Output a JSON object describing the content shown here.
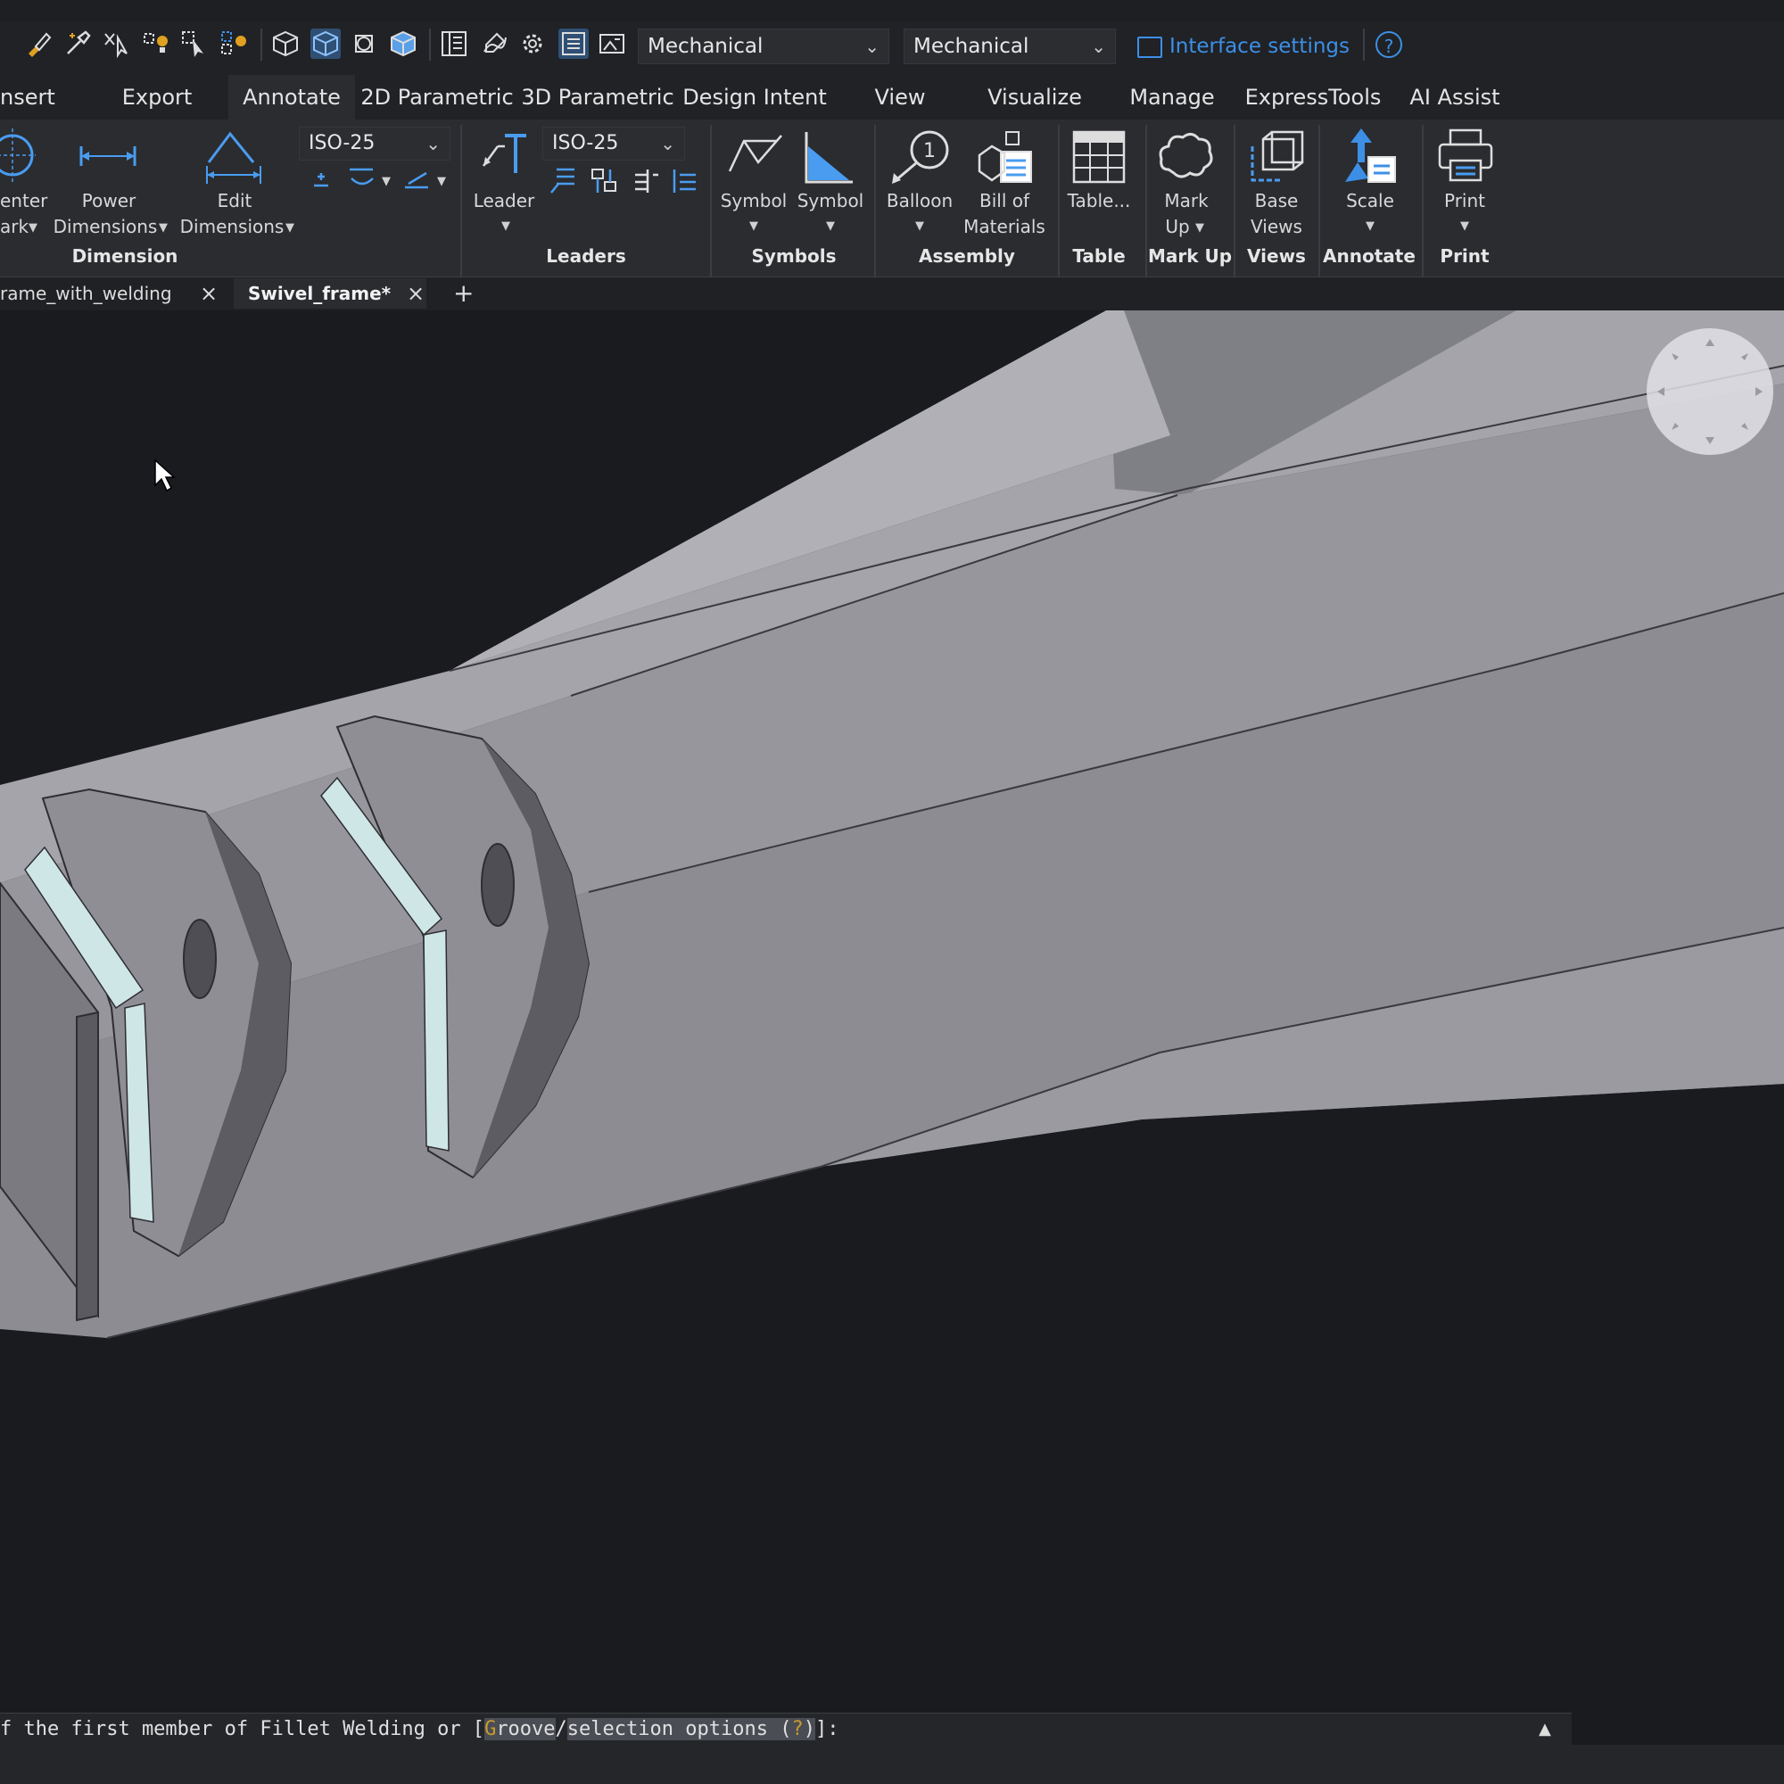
{
  "toolbar": {
    "icons": [
      "brush-icon",
      "eyedropper-icon",
      "select-filter-icon",
      "bulb-select-icon",
      "select-similar-icon",
      "bulb-multi-icon",
      "cube-wireframe-icon",
      "cube-shaded-icon",
      "visual-style-icon",
      "cube-render-icon",
      "properties-panel-icon",
      "draw-pen-icon",
      "gear-icon",
      "layer-panel-icon",
      "image-panel-icon"
    ],
    "workspace_value": "Mechanical",
    "style_value": "Mechanical",
    "interface_settings_label": "Interface settings",
    "help_label": "?"
  },
  "ribbon_tabs": [
    "nsert",
    "Export",
    "Annotate",
    "2D Parametric",
    "3D Parametric",
    "Design Intent",
    "View",
    "Visualize",
    "Manage",
    "ExpressTools",
    "AI Assist"
  ],
  "ribbon": {
    "center_mark_label_1": "enter",
    "center_mark_label_2": "ark",
    "power_dimensions_label_1": "Power",
    "power_dimensions_label_2": "Dimensions",
    "edit_dimensions_label_1": "Edit",
    "edit_dimensions_label_2": "Dimensions",
    "dimension_style_value": "ISO-25",
    "leader_label": "Leader",
    "leader_style_value": "ISO-25",
    "symbol1_label": "Symbol",
    "symbol2_label": "Symbol",
    "balloon_label": "Balloon",
    "balloon_number": "1",
    "bom_label_1": "Bill of",
    "bom_label_2": "Materials",
    "table_label": "Table...",
    "markup_label_1": "Mark",
    "markup_label_2": "Up",
    "baseviews_label_1": "Base",
    "baseviews_label_2": "Views",
    "scale_label": "Scale",
    "print_label": "Print",
    "groups": {
      "dimension": "Dimension",
      "leaders": "Leaders",
      "symbols": "Symbols",
      "assembly": "Assembly",
      "table": "Table",
      "markup": "Mark Up",
      "views": "Views",
      "annotate": "Annotate",
      "print": "Print"
    }
  },
  "document_tabs": [
    {
      "label": "rame_with_welding",
      "active": false
    },
    {
      "label": "Swivel_frame*",
      "active": true
    }
  ],
  "new_tab_label": "+",
  "close_label": "×",
  "command_line": {
    "prefix": "f the first member of Fillet Welding or [",
    "option1_key": "G",
    "option1_rest": "roove",
    "divider": "/",
    "option2_text": "selection options (",
    "option2_key": "?",
    "option2_end": ")",
    "suffix": "]:"
  },
  "colors": {
    "accent": "#3d8fe6",
    "weld_bead": "#cfe6e6",
    "part_light": "#a6a6ac",
    "part_mid": "#8e8e94",
    "part_dark": "#56565c",
    "background": "#1a1b1e"
  }
}
